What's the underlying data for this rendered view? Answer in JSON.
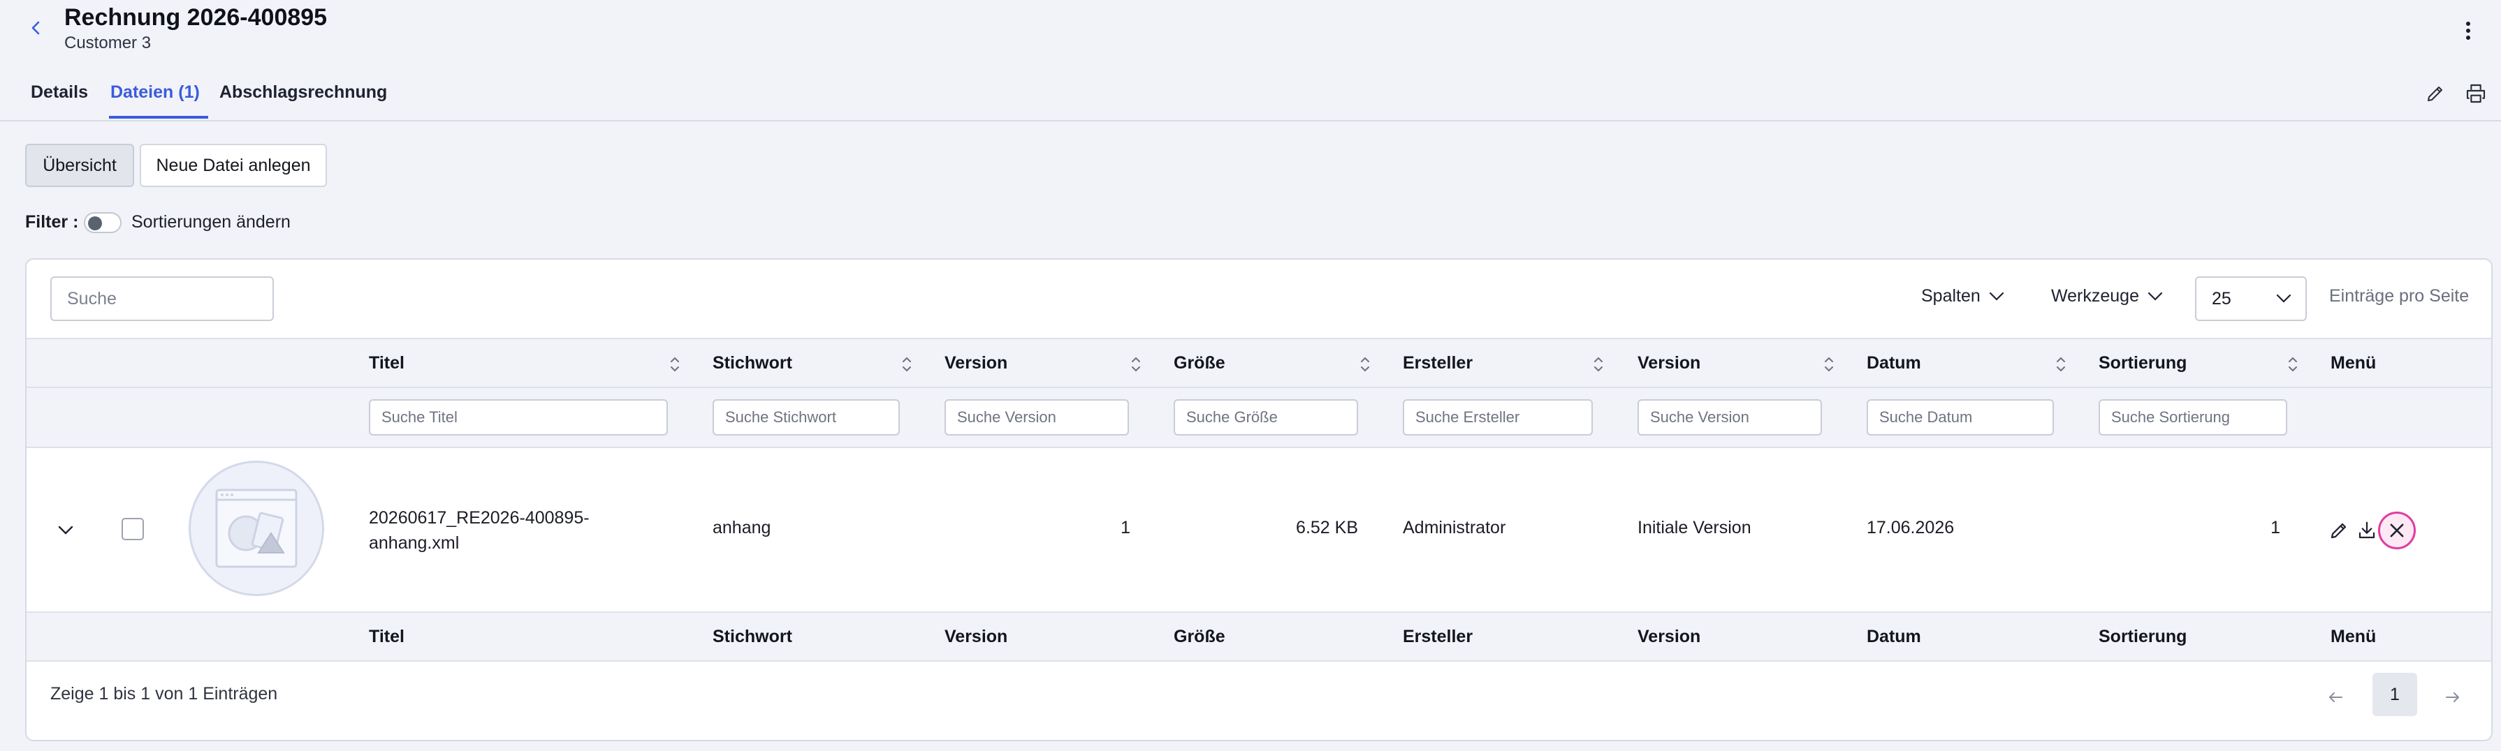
{
  "header": {
    "title": "Rechnung 2026-400895",
    "subtitle": "Customer 3"
  },
  "tabs": [
    {
      "label": "Details"
    },
    {
      "label": "Dateien (1)"
    },
    {
      "label": "Abschlagsrechnung"
    }
  ],
  "toolbar": {
    "overview_label": "Übersicht",
    "new_file_label": "Neue Datei anlegen",
    "filter_label": "Filter",
    "sort_toggle_label": "Sortierungen ändern"
  },
  "table_controls": {
    "search_placeholder": "Suche",
    "columns_label": "Spalten",
    "tools_label": "Werkzeuge",
    "per_page_value": "25",
    "per_page_label": "Einträge pro Seite"
  },
  "columns": [
    {
      "label": "Titel",
      "search_placeholder": "Suche Titel"
    },
    {
      "label": "Stichwort",
      "search_placeholder": "Suche Stichwort"
    },
    {
      "label": "Version",
      "search_placeholder": "Suche Version"
    },
    {
      "label": "Größe",
      "search_placeholder": "Suche Größe"
    },
    {
      "label": "Ersteller",
      "search_placeholder": "Suche Ersteller"
    },
    {
      "label": "Version",
      "search_placeholder": "Suche Version"
    },
    {
      "label": "Datum",
      "search_placeholder": "Suche Datum"
    },
    {
      "label": "Sortierung",
      "search_placeholder": "Suche Sortierung"
    },
    {
      "label": "Menü"
    }
  ],
  "rows": [
    {
      "title_line1": "20260617_RE2026-400895-",
      "title_line2": "anhang.xml",
      "keyword": "anhang",
      "version": "1",
      "size": "6.52 KB",
      "creator": "Administrator",
      "version_name": "Initiale Version",
      "date": "17.06.2026",
      "sort": "1"
    }
  ],
  "footer": {
    "status": "Zeige 1 bis 1 von 1 Einträgen",
    "current_page": "1"
  },
  "colors": {
    "accent": "#3b5bdb",
    "delete_highlight": "#e13ca0",
    "background": "#f1f3f9"
  },
  "icons": [
    "chevron-left-icon",
    "kebab-menu-icon",
    "pencil-icon",
    "printer-icon",
    "chevron-down-icon",
    "sort-icon",
    "file-placeholder-icon",
    "download-icon",
    "close-icon",
    "arrow-left-icon",
    "arrow-right-icon"
  ]
}
